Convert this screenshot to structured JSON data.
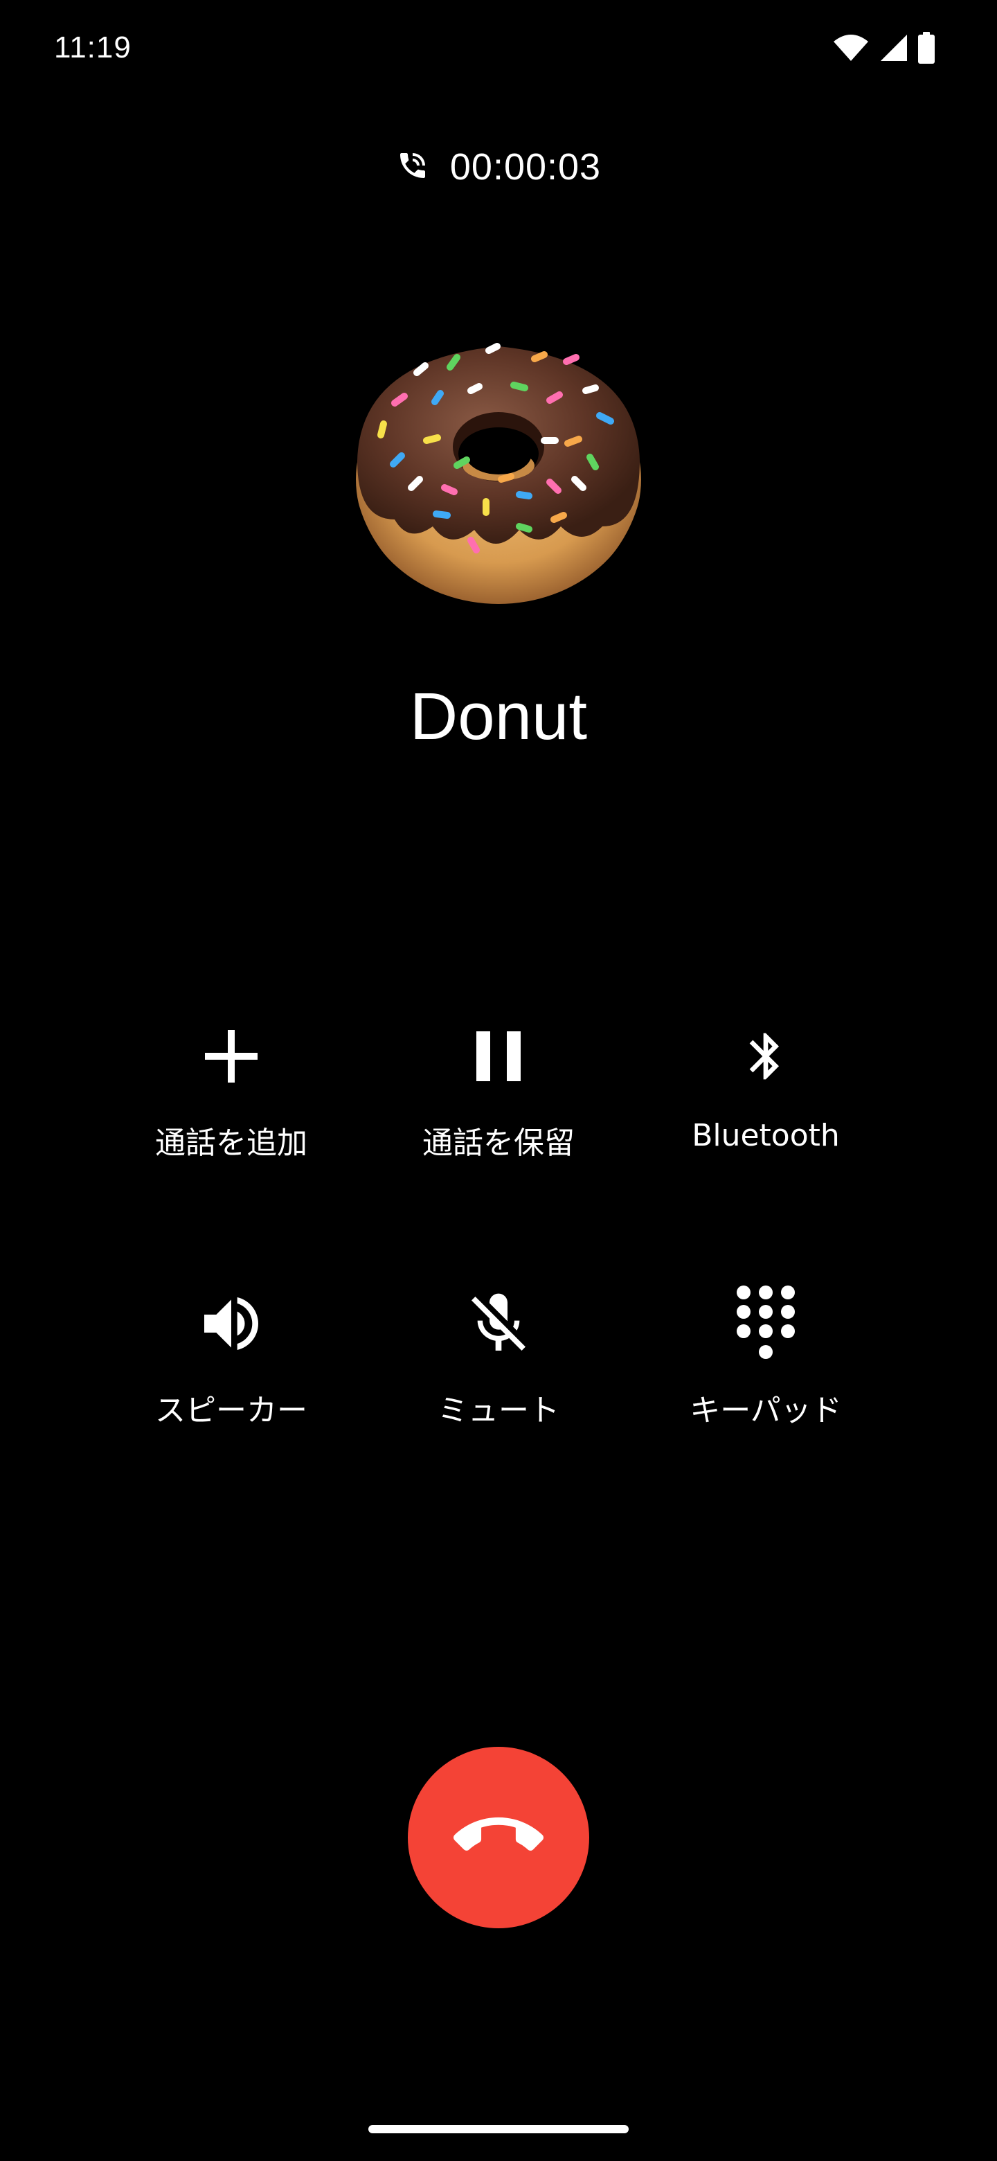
{
  "status_bar": {
    "time": "11:19",
    "icons": [
      "wifi-icon",
      "cellular-signal-icon",
      "battery-icon"
    ]
  },
  "call": {
    "timer": "00:00:03",
    "timer_icon": "phone-in-talk-icon",
    "contact_name": "Donut",
    "avatar": "donut-emoji"
  },
  "controls": {
    "add_call": {
      "label": "通話を追加",
      "icon": "plus-icon"
    },
    "hold": {
      "label": "通話を保留",
      "icon": "pause-icon"
    },
    "bluetooth": {
      "label": "Bluetooth",
      "icon": "bluetooth-icon"
    },
    "speaker": {
      "label": "スピーカー",
      "icon": "volume-icon"
    },
    "mute": {
      "label": "ミュート",
      "icon": "mic-off-icon"
    },
    "keypad": {
      "label": "キーパッド",
      "icon": "dialpad-icon"
    }
  },
  "end_call": {
    "icon": "call-end-icon",
    "color": "#f44336"
  },
  "colors": {
    "background": "#000000",
    "foreground": "#ffffff",
    "end_call": "#f44336"
  }
}
